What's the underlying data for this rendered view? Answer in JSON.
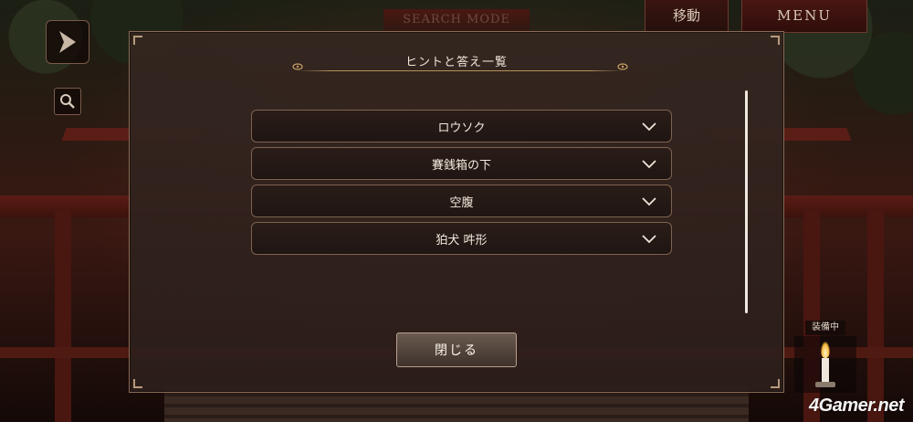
{
  "header": {
    "mode_label": "SEARCH MODE",
    "move_label": "移動",
    "menu_label": "MENU"
  },
  "dialog": {
    "title": "ヒントと答え一覧",
    "items": [
      {
        "label": "ロウソク"
      },
      {
        "label": "賽銭箱の下"
      },
      {
        "label": "空腹"
      },
      {
        "label": "狛犬 吽形"
      }
    ],
    "close_label": "閉じる"
  },
  "equipment": {
    "label": "装備中",
    "item_icon": "candle-icon"
  },
  "watermark": "4Gamer.net",
  "colors": {
    "accent_gold": "#b8905a",
    "panel_bg": "#342620",
    "shrine_red": "#5a1e16"
  }
}
